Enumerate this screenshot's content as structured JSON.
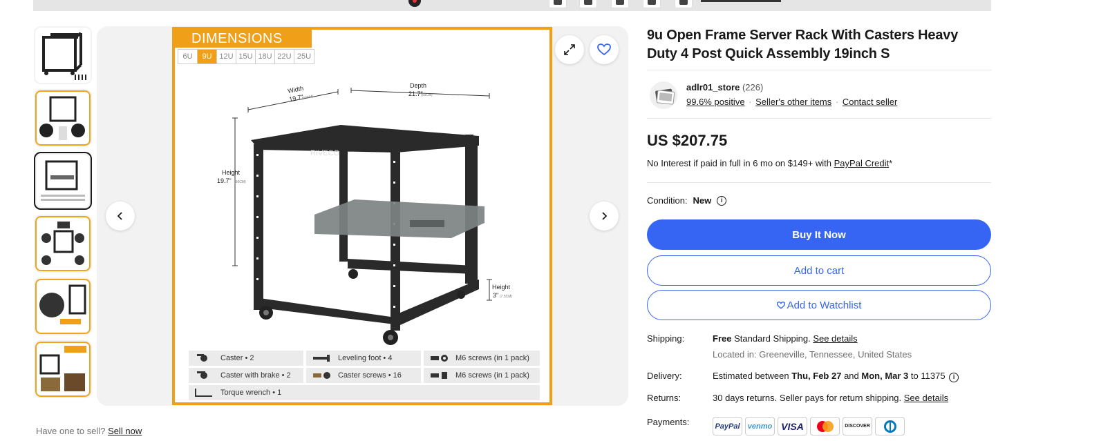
{
  "product": {
    "title": "9u Open Frame Server Rack With Casters Heavy Duty 4 Post Quick Assembly 19inch S",
    "image": {
      "dimensions_title": "DIMENSIONS",
      "sizes": [
        "6U",
        "9U",
        "12U",
        "15U",
        "18U",
        "22U",
        "25U"
      ],
      "selected_size": "9U",
      "brand": "RIVECO",
      "width_label": "Width",
      "width_value": "19.7\"",
      "width_metric": "(50CM)",
      "depth_label": "Depth",
      "depth_value": "21.7\"",
      "depth_metric": "(55CM)",
      "height_label": "Height",
      "height_value": "19.7\"",
      "height_metric": "(50CM)",
      "caster_height_label": "Height",
      "caster_height_value": "3\"",
      "caster_height_metric": "(7.5CM)",
      "parts": [
        "Caster • 2",
        "Leveling foot • 4",
        "M6 screws (in 1 pack)",
        "Caster with brake • 2",
        "Caster screws • 16",
        "M6 screws (in 1 pack)",
        "Torque wrench • 1"
      ]
    }
  },
  "seller": {
    "name": "adlr01_store",
    "feedback_count": "(226)",
    "positive": "99.6% positive",
    "other_items": "Seller's other items",
    "contact": "Contact seller"
  },
  "price": "US $207.75",
  "credit": {
    "text": "No Interest if paid in full in 6 mo on $149+ with",
    "link": "PayPal Credit",
    "suffix": "*"
  },
  "condition": {
    "label": "Condition:",
    "value": "New"
  },
  "buttons": {
    "buy": "Buy It Now",
    "cart": "Add to cart",
    "watch": "Add to Watchlist"
  },
  "shipping": {
    "label": "Shipping:",
    "free": "Free",
    "text": "Standard Shipping.",
    "link": "See details",
    "location": "Located in: Greeneville, Tennessee, United States"
  },
  "delivery": {
    "label": "Delivery:",
    "prefix": "Estimated between",
    "start": "Thu, Feb 27",
    "and": "and",
    "end": "Mon, Mar 3",
    "to": "to 11375"
  },
  "returns": {
    "label": "Returns:",
    "text": "30 days returns. Seller pays for return shipping.",
    "link": "See details"
  },
  "payments": {
    "label": "Payments:",
    "methods": [
      "PayPal",
      "venmo",
      "VISA",
      "",
      "DISCOVER",
      ""
    ]
  },
  "bottom": {
    "text": "Have one to sell?",
    "link": "Sell now"
  },
  "colors": {
    "accent": "#3665f3",
    "orange": "#f0a018"
  }
}
